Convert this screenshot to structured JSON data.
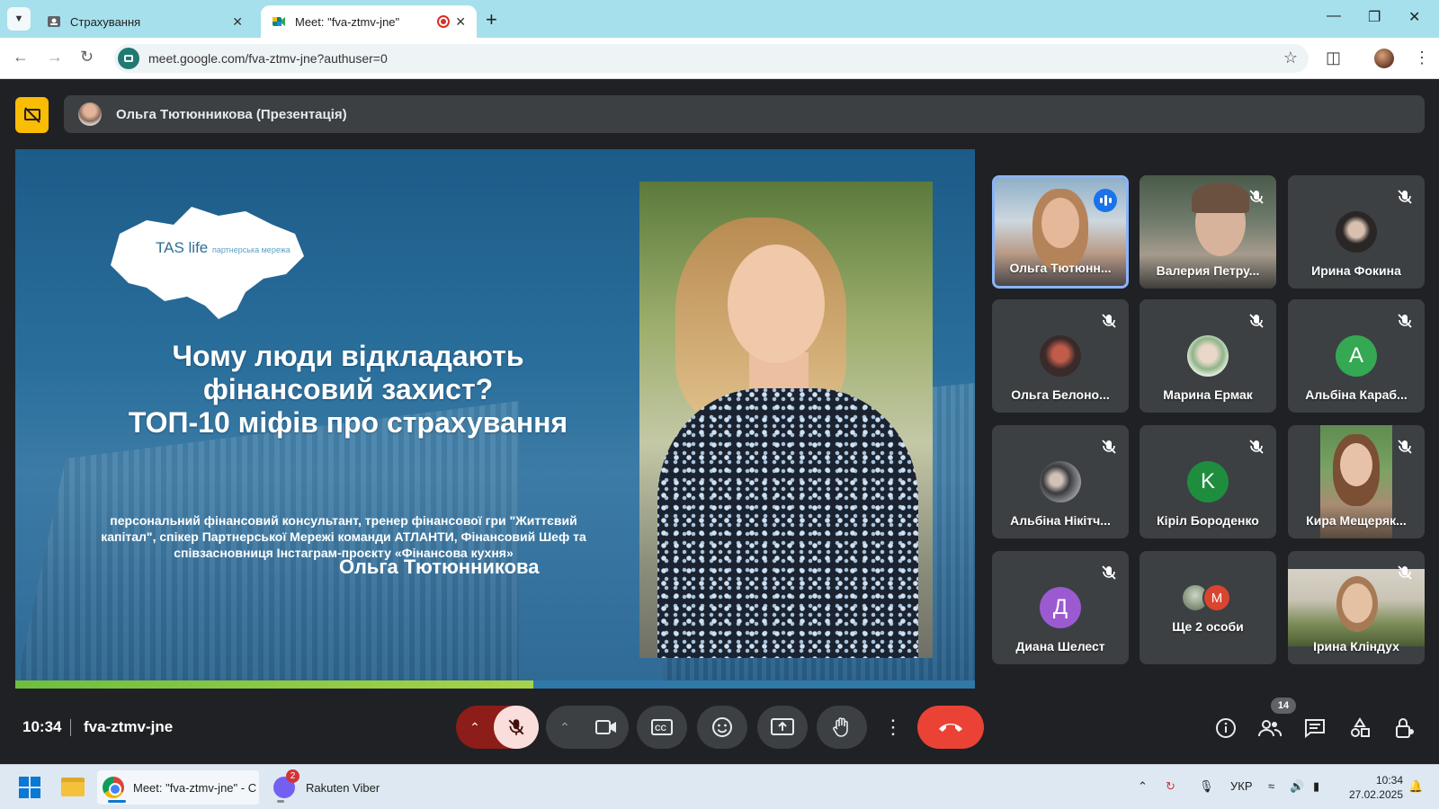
{
  "browser": {
    "tabs": [
      {
        "title": "Страхування",
        "active": false
      },
      {
        "title": "Meet: \"fva-ztmv-jne\"",
        "active": true,
        "recording": true
      }
    ],
    "url": "meet.google.com/fva-ztmv-jne?authuser=0"
  },
  "meet": {
    "presenter_label": "Ольга Тютюнникова (Презентація)",
    "slide": {
      "logo_text": "TAS life",
      "logo_sub": "партнерська мережа",
      "title_lines": [
        "Чому люди відкладають",
        "фінансовий захист?",
        "ТОП-10 міфів про страхування"
      ],
      "description_lines": [
        "персональний фінансовий консультант, тренер фінансової гри \"Життєвий",
        "капітал\", спікер Партнерської Мережі команди АТЛАНТИ, Фінансовий Шеф та",
        "співзасновниця Інстаграм-проєкту «Фінансова кухня»"
      ],
      "speaker_name": "Ольга Тютюнникова",
      "progress": 0.54
    },
    "participants": [
      {
        "name": "Ольга Тютюнн...",
        "type": "video",
        "speaking": true,
        "muted": false
      },
      {
        "name": "Валерия Петру...",
        "type": "video",
        "muted": true
      },
      {
        "name": "Ирина Фокина",
        "type": "photo",
        "muted": true
      },
      {
        "name": "Ольга Белоно...",
        "type": "photo",
        "muted": true
      },
      {
        "name": "Марина Ермак",
        "type": "photo",
        "muted": true
      },
      {
        "name": "Альбіна Караб...",
        "type": "initial",
        "initial": "A",
        "color": "#34a853",
        "muted": true
      },
      {
        "name": "Альбіна Нікітч...",
        "type": "photo",
        "muted": true
      },
      {
        "name": "Кіріл Бороденко",
        "type": "initial",
        "initial": "K",
        "color": "#1e8e3e",
        "muted": true
      },
      {
        "name": "Кира Мещеряк...",
        "type": "video",
        "muted": true
      },
      {
        "name": "Диана Шелест",
        "type": "initial",
        "initial": "Д",
        "color": "#9c5ad1",
        "muted": true
      },
      {
        "name": "Ще 2 особи",
        "type": "more",
        "initial": "M",
        "color": "#d9452f"
      },
      {
        "name": "Ірина Кліндух",
        "type": "video",
        "muted": true
      }
    ],
    "time": "10:34",
    "meeting_code": "fva-ztmv-jne",
    "participant_count": "14"
  },
  "taskbar": {
    "chrome_label": "Meet: \"fva-ztmv-jne\" - C",
    "viber_label": "Rakuten Viber",
    "viber_badge": "2",
    "language": "УКР",
    "time": "10:34",
    "date": "27.02.2025"
  },
  "colors": {
    "meet_bg": "#202124",
    "tile_bg": "#3c4043",
    "end_call": "#ea4335",
    "mic_off_bg": "#f9dedc",
    "accent_blue": "#8ab4f8"
  }
}
